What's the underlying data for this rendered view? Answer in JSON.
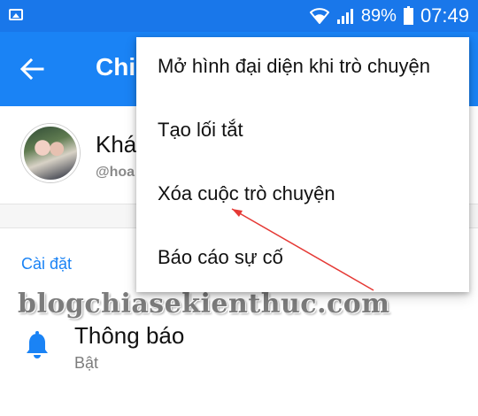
{
  "status_bar": {
    "battery_percent": "89%",
    "time": "07:49"
  },
  "app_bar": {
    "title": "Chi"
  },
  "profile": {
    "name": "Khá",
    "username": "@hoa"
  },
  "settings_section": {
    "header": "Cài đặt",
    "items": [
      {
        "title": "Thông báo",
        "subtitle": "Bật"
      }
    ]
  },
  "watermark": "blogchiasekienthuc.com",
  "menu": {
    "items": [
      {
        "label": "Mở hình đại diện khi trò chuyện"
      },
      {
        "label": "Tạo lối tắt"
      },
      {
        "label": "Xóa cuộc trò chuyện"
      },
      {
        "label": "Báo cáo sự cố"
      }
    ]
  },
  "colors": {
    "status_bar": "#1977ea",
    "app_bar": "#1a83f5",
    "accent": "#1a83f5",
    "annotation_arrow": "#e53935"
  }
}
